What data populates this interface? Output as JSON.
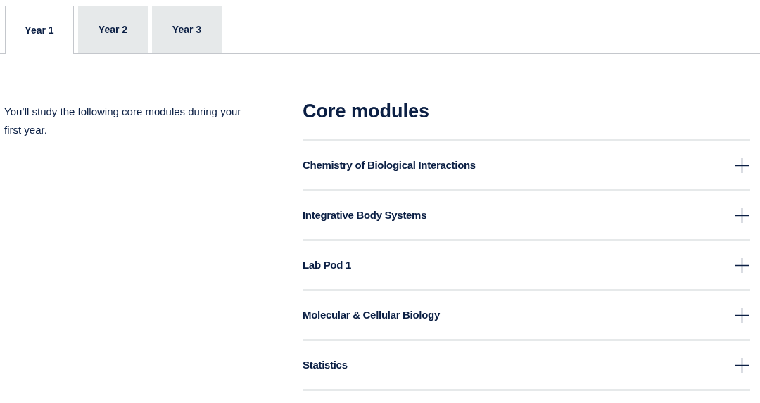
{
  "tabs": [
    {
      "label": "Year 1",
      "selected": true
    },
    {
      "label": "Year 2",
      "selected": false
    },
    {
      "label": "Year 3",
      "selected": false
    }
  ],
  "intro": "You’ll study the following core modules during your first year.",
  "modules": {
    "title": "Core modules",
    "items": [
      {
        "label": "Chemistry of Biological Interactions",
        "expanded": false
      },
      {
        "label": "Integrative Body Systems",
        "expanded": false
      },
      {
        "label": "Lab Pod 1",
        "expanded": false
      },
      {
        "label": "Molecular & Cellular Biology",
        "expanded": false
      },
      {
        "label": "Statistics",
        "expanded": false
      }
    ]
  }
}
